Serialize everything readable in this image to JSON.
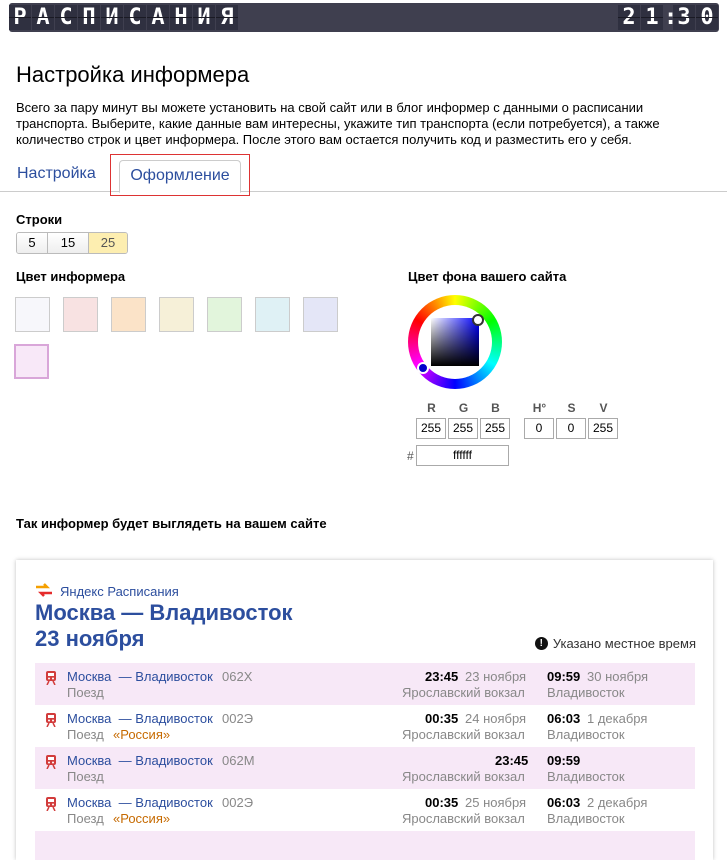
{
  "header": {
    "title_letters": [
      "Р",
      "А",
      "С",
      "П",
      "И",
      "С",
      "А",
      "Н",
      "И",
      "Я"
    ],
    "clock_digits": [
      "2",
      "1",
      "3",
      "0"
    ]
  },
  "page": {
    "title": "Настройка информера",
    "intro": "Всего за пару минут вы можете установить на свой сайт или в блог информер с данными о расписании транспорта. Выберите, какие данные вам интересны, укажите тип транспорта (если потребуется), а также количество строк и цвет информера. После этого вам остается получить код и разместить его у себя."
  },
  "tabs": [
    {
      "label": "Настройка",
      "active": false
    },
    {
      "label": "Оформление",
      "active": true
    }
  ],
  "rows_setting": {
    "label": "Строки",
    "options": [
      "5",
      "15",
      "25"
    ],
    "selected": "25"
  },
  "informer_color": {
    "label": "Цвет информера",
    "swatches": [
      "#f7f7fb",
      "#f8e2e2",
      "#fbe3c8",
      "#f6f0d8",
      "#e2f5dc",
      "#dff1f5",
      "#e4e6f7",
      "#f8e8f8"
    ],
    "selected_index": 7
  },
  "site_bg": {
    "label": "Цвет фона вашего сайта",
    "r_label": "R",
    "g_label": "G",
    "b_label": "B",
    "h_label": "H°",
    "s_label": "S",
    "v_label": "V",
    "r": "255",
    "g": "255",
    "b": "255",
    "h": "0",
    "s": "0",
    "v": "255",
    "hash": "#",
    "hex": "ffffff"
  },
  "preview": {
    "label": "Так информер будет выглядеть на вашем сайте",
    "brand": "Яндекс Расписания",
    "route": "Москва — Владивосток",
    "date": "23 ноября",
    "local_time_note": "Указано местное время",
    "info_glyph": "!",
    "rows": [
      {
        "name": "Москва — Владивосток",
        "number": "062Х",
        "kind": "Поезд",
        "brand": "",
        "dep_time": "23:45",
        "dep_date": "23 ноября",
        "dep_station": "Ярославский вокзал",
        "arr_time": "09:59",
        "arr_date": "30 ноября",
        "arr_station": "Владивосток"
      },
      {
        "name": "Москва — Владивосток",
        "number": "002Э",
        "kind": "Поезд",
        "brand": "«Россия»",
        "dep_time": "00:35",
        "dep_date": "24 ноября",
        "dep_station": "Ярославский вокзал",
        "arr_time": "06:03",
        "arr_date": "1 декабря",
        "arr_station": "Владивосток"
      },
      {
        "name": "Москва — Владивосток",
        "number": "062М",
        "kind": "Поезд",
        "brand": "",
        "dep_time": "23:45",
        "dep_date": "",
        "dep_station": "Ярославский вокзал",
        "arr_time": "09:59",
        "arr_date": "",
        "arr_station": "Владивосток"
      },
      {
        "name": "Москва — Владивосток",
        "number": "002Э",
        "kind": "Поезд",
        "brand": "«Россия»",
        "dep_time": "00:35",
        "dep_date": "25 ноября",
        "dep_station": "Ярославский вокзал",
        "arr_time": "06:03",
        "arr_date": "2 декабря",
        "arr_station": "Владивосток"
      }
    ]
  },
  "colors": {
    "link": "#2c4e9e",
    "row_alt": "#f7e8f7",
    "brand_orange": "#c66a00",
    "train_icon": "#d23c3c"
  }
}
